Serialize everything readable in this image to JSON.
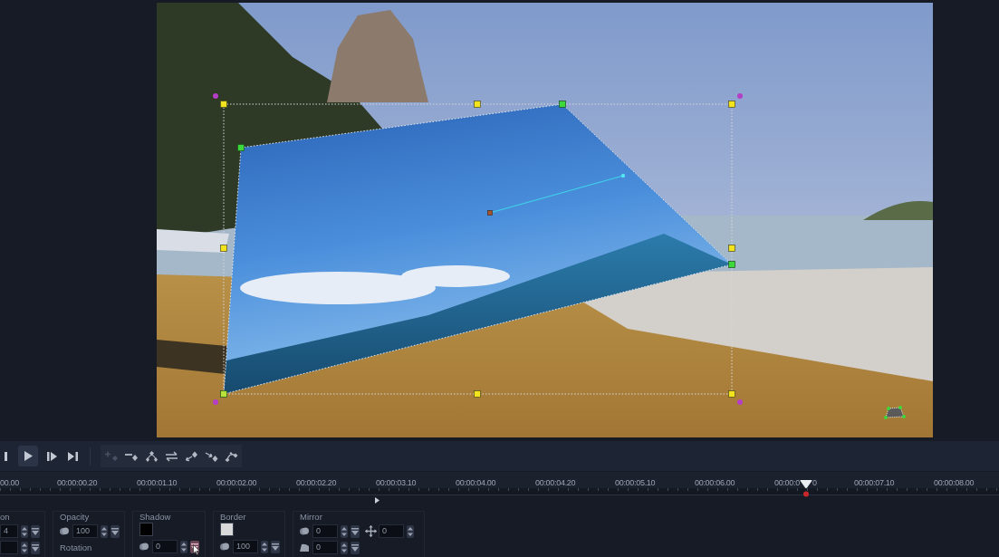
{
  "transport": [
    {
      "kind": "step_back",
      "selected": false
    },
    {
      "kind": "play",
      "selected": true
    },
    {
      "kind": "step_forward",
      "selected": false
    },
    {
      "kind": "end",
      "selected": false
    }
  ],
  "motion_tools": [
    {
      "kind": "add",
      "disabled": true
    },
    {
      "kind": "remove",
      "disabled": false
    },
    {
      "kind": "spread",
      "disabled": false
    },
    {
      "kind": "swap",
      "disabled": false
    },
    {
      "kind": "back",
      "disabled": false
    },
    {
      "kind": "forward",
      "disabled": false
    },
    {
      "kind": "curve",
      "disabled": false
    }
  ],
  "ruler": {
    "labels": [
      {
        "text": "00.00"
      },
      {
        "text": "00:00:00.20"
      },
      {
        "text": "00:00:01.10"
      },
      {
        "text": "00:00:02.00"
      },
      {
        "text": "00:00:02.20"
      },
      {
        "text": "00:00:03.10"
      },
      {
        "text": "00:00:04.00"
      },
      {
        "text": "00:00:04.20"
      },
      {
        "text": "00:00:05.10"
      },
      {
        "text": "00:00:06.00"
      },
      {
        "text": "00:00:0",
        "tail": "0",
        "playhead": true
      },
      {
        "text": "00:00:07.10"
      },
      {
        "text": "00:00:08.00"
      }
    ]
  },
  "properties": [
    {
      "label": "on",
      "rows": [
        [
          {
            "kind": "plain",
            "value": "4",
            "reset": true,
            "hovered": false
          }
        ],
        [
          {
            "kind": "plain",
            "reset": true,
            "hovered": false
          }
        ]
      ]
    },
    {
      "label": "Opacity",
      "rows": [
        [
          {
            "kind": "blend",
            "value": "100",
            "reset": true,
            "hovered": false
          }
        ]
      ],
      "sublabel": "Rotation"
    },
    {
      "label": "Shadow",
      "swatch": {
        "color": "#000000"
      },
      "rows": [
        [
          {
            "kind": "blend",
            "value": "0",
            "reset": true,
            "hovered": true
          }
        ]
      ]
    },
    {
      "label": "Border",
      "swatch": {
        "color": "#d9d9d9"
      },
      "rows": [
        [
          {
            "kind": "blend",
            "value": "100",
            "reset": true,
            "hovered": false
          }
        ]
      ]
    },
    {
      "label": "Mirror",
      "rows": [
        [
          {
            "kind": "blend",
            "value": "0",
            "reset": true,
            "hovered": false
          },
          {
            "kind": "offset",
            "value": "0",
            "reset": false
          }
        ],
        [
          {
            "kind": "slant",
            "value": "0",
            "reset": true,
            "hovered": false
          }
        ]
      ]
    }
  ]
}
